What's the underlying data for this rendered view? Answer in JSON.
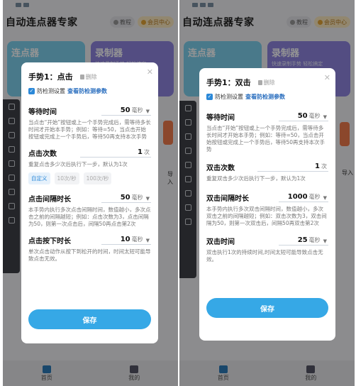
{
  "app_title": "自动连点器专家",
  "btn_tutorial": "教程",
  "btn_vip": "会员中心",
  "tiles": {
    "clicker": "连点器",
    "recorder": "录制器",
    "recorder_sub": "快速录制手势 轻松搞定"
  },
  "side_import": "导入",
  "tabs": {
    "home": "首页",
    "mine": "我的"
  },
  "dialog_click": {
    "title": "手势1：点击",
    "delete": "删除",
    "anti_label": "防检测设置",
    "anti_link": "查看防检测参数",
    "wait": {
      "label": "等待时间",
      "value": "50",
      "unit": "毫秒",
      "desc": "当点击“开始”按钮或上一个手势完成后，需等待多长时间才开始本手势；例如：等待=50，当点击开始按钮或完成上一个手势后，等待50再支持本次手势"
    },
    "count": {
      "label": "点击次数",
      "value": "1",
      "unit": "次",
      "desc": "重复点击多少次后执行下一步，默认为1次",
      "chips": [
        "自定义",
        "10次/秒",
        "100次/秒"
      ]
    },
    "interval": {
      "label": "点击间隔时长",
      "value": "50",
      "unit": "毫秒",
      "desc": "本手势内执行多次点击间隔时间，数值越小，多次点击之前的间隔越短；例如：点击次数为3，点击间隔为50，则第一次点击后，间隔50再点击第2次"
    },
    "press": {
      "label": "点击按下时长",
      "value": "10",
      "unit": "毫秒",
      "desc": "单次点击动作从按下到松开的时间，时间太短可能导致点击无效。"
    },
    "save": "保存"
  },
  "dialog_double": {
    "title": "手势1：双击",
    "delete": "删除",
    "anti_label": "防检测设置",
    "anti_link": "查看防检测参数",
    "wait": {
      "label": "等待时间",
      "value": "50",
      "unit": "毫秒",
      "desc": "当点击“开始”按钮或上一个手势完成后，需等待多长时间才开始本手势；例如：等待=50，当点击开始按钮或完成上一个手势后，等待50再支持本次手势"
    },
    "count": {
      "label": "双击次数",
      "value": "1",
      "unit": "次",
      "desc": "重复双击多少次后执行下一步，默认为1次"
    },
    "interval": {
      "label": "双击间隔时长",
      "value": "1000",
      "unit": "毫秒",
      "desc": "本手势内执行多次双击间隔时间，数值越小，多次双击之前的间隔越短；例如：双击次数为3，双击间隔为50，则第一次双击后，间隔50再双击第2次"
    },
    "duration": {
      "label": "双击时间",
      "value": "25",
      "unit": "毫秒",
      "desc": "双击执行1次的持续时间,时间太短可能导致点击无效。"
    },
    "save": "保存"
  }
}
